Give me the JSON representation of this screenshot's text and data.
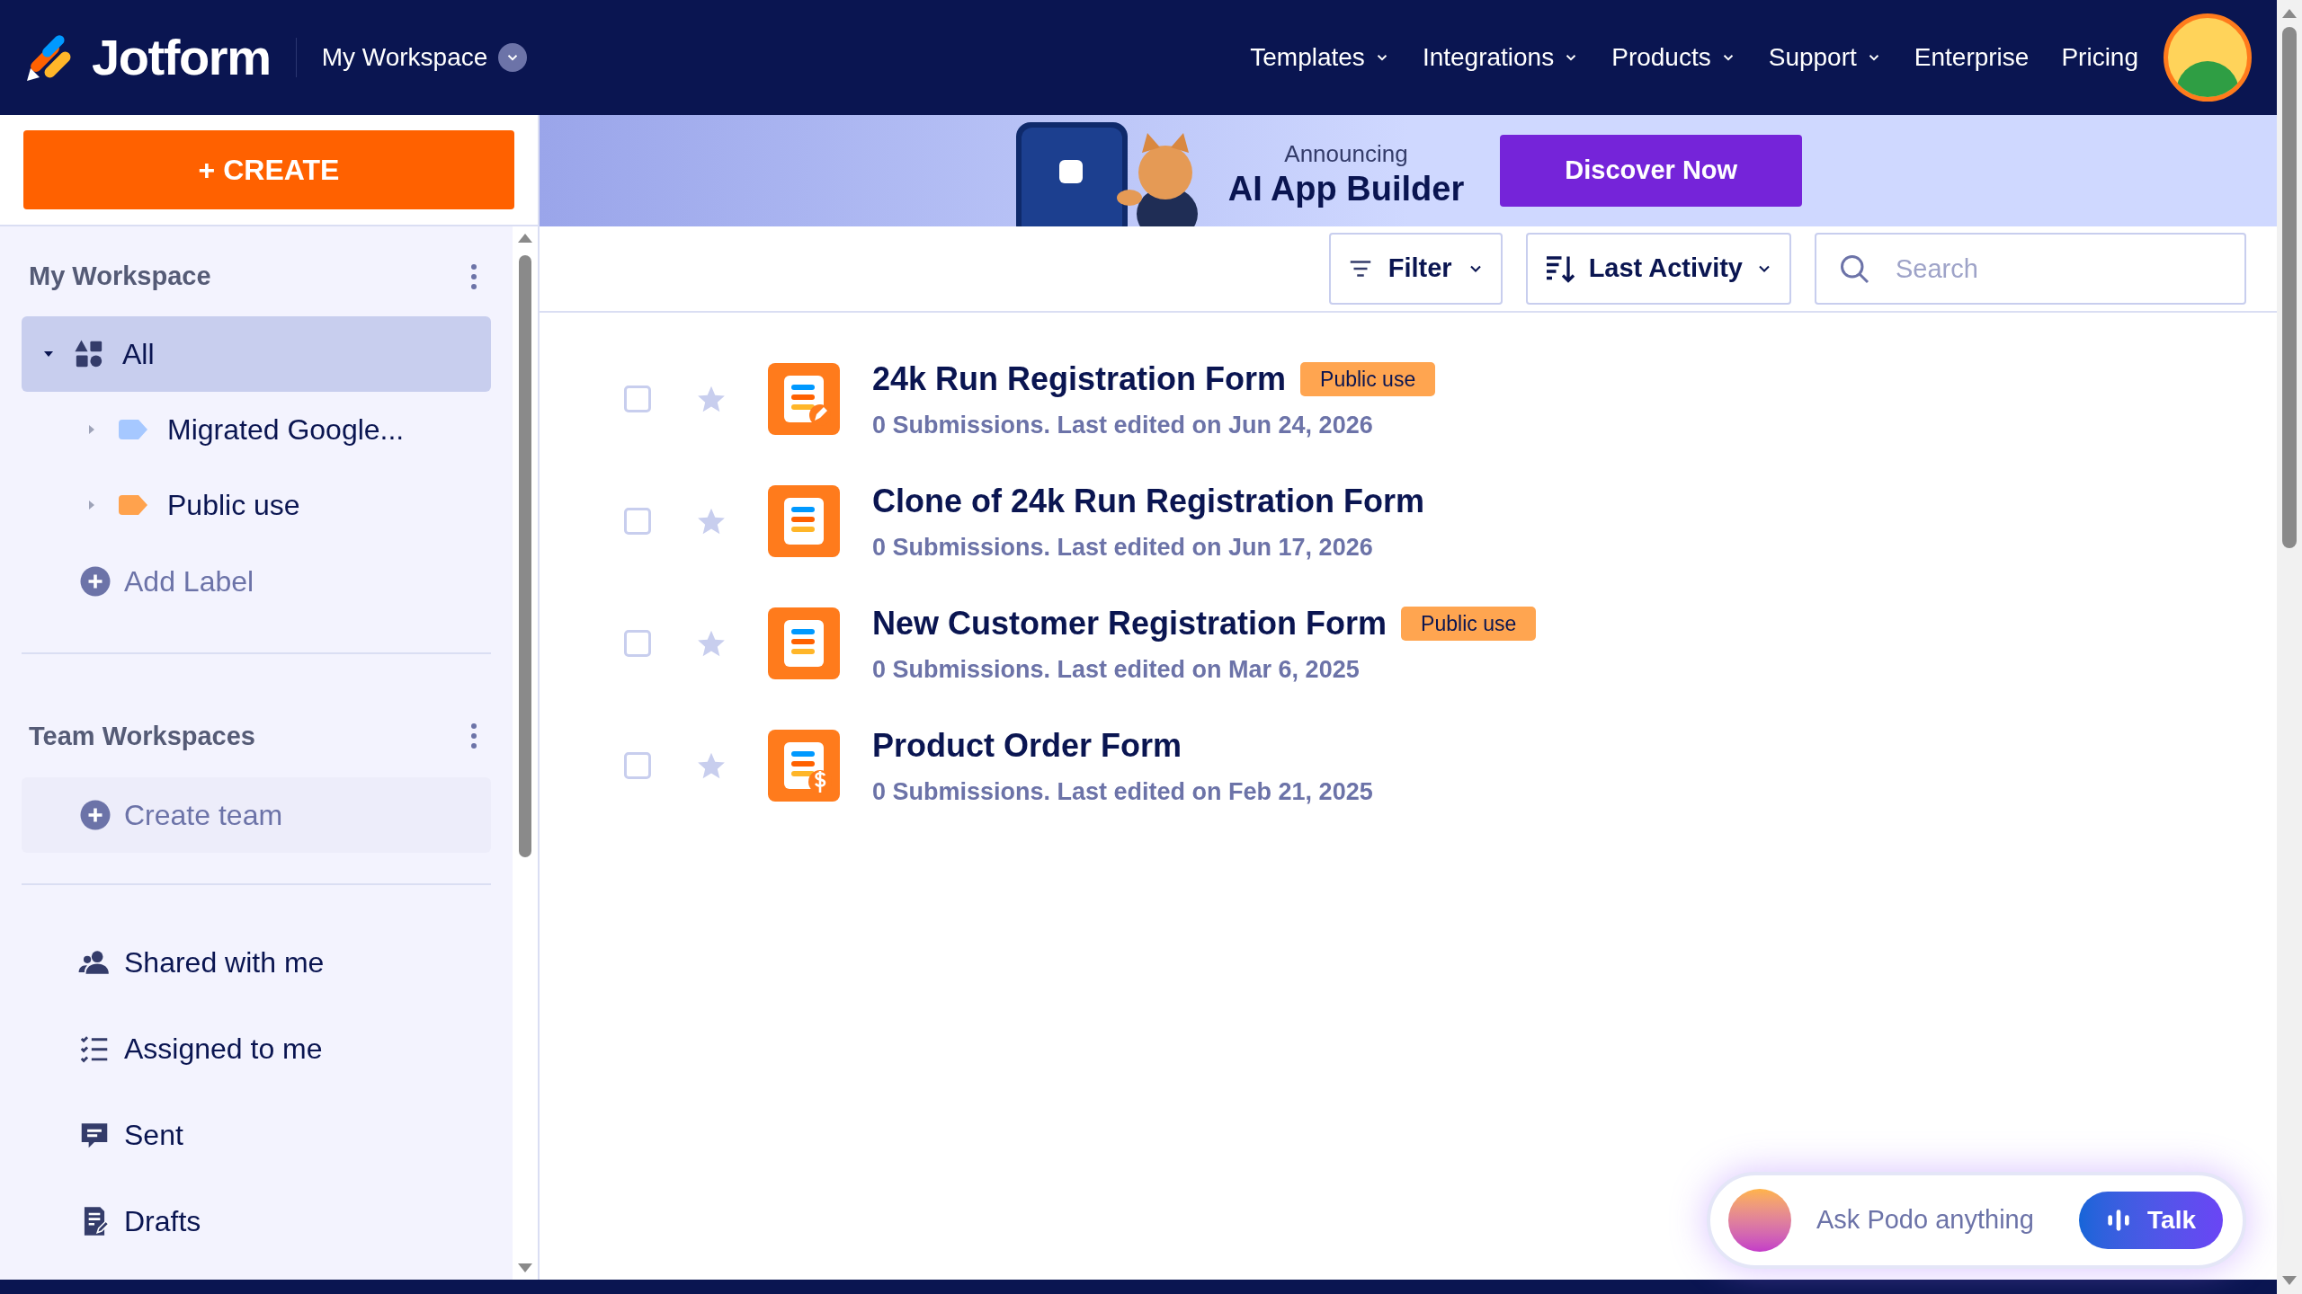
{
  "header": {
    "logo_text": "Jotform",
    "workspace": "My Workspace",
    "nav": [
      {
        "label": "Templates",
        "has_menu": true
      },
      {
        "label": "Integrations",
        "has_menu": true
      },
      {
        "label": "Products",
        "has_menu": true
      },
      {
        "label": "Support",
        "has_menu": true
      },
      {
        "label": "Enterprise",
        "has_menu": false
      },
      {
        "label": "Pricing",
        "has_menu": false
      }
    ]
  },
  "create_button": "+ CREATE",
  "banner": {
    "kicker": "Announcing",
    "title": "AI App Builder",
    "button": "Discover Now"
  },
  "sidebar": {
    "my_workspace": "My Workspace",
    "tree": [
      {
        "label": "All",
        "expanded": true,
        "selected": true,
        "children": [
          {
            "label": "Migrated Google...",
            "color": "#a6c8ff",
            "expanded": false,
            "selected": false
          },
          {
            "label": "Public use",
            "color": "#ffa24d",
            "expanded": false,
            "selected": false
          }
        ]
      }
    ],
    "add_label": "Add Label",
    "team_workspaces": "Team Workspaces",
    "create_team": "Create team",
    "links": [
      {
        "kind": "shared",
        "label": "Shared with me"
      },
      {
        "kind": "assigned",
        "label": "Assigned to me"
      },
      {
        "kind": "sent",
        "label": "Sent"
      },
      {
        "kind": "drafts",
        "label": "Drafts"
      }
    ]
  },
  "toolbar": {
    "filter": "Filter",
    "sort": "Last Activity",
    "search_placeholder": "Search"
  },
  "forms": [
    {
      "kind": "pen",
      "title": "24k Run Registration Form",
      "tag": "Public use",
      "subtitle": "0 Submissions. Last edited on Jun 24, 2026",
      "checked": false,
      "starred": false
    },
    {
      "kind": "plain",
      "title": "Clone of 24k Run Registration Form",
      "subtitle": "0 Submissions. Last edited on Jun 17, 2026",
      "checked": false,
      "starred": false
    },
    {
      "kind": "plain",
      "title": "New Customer Registration Form",
      "tag": "Public use",
      "subtitle": "0 Submissions. Last edited on Mar 6, 2025",
      "checked": false,
      "starred": false
    },
    {
      "kind": "dollar",
      "title": "Product Order Form",
      "subtitle": "0 Submissions. Last edited on Feb 21, 2025",
      "checked": false,
      "starred": false
    }
  ],
  "assistant": {
    "placeholder": "Ask Podo anything",
    "button": "Talk"
  }
}
